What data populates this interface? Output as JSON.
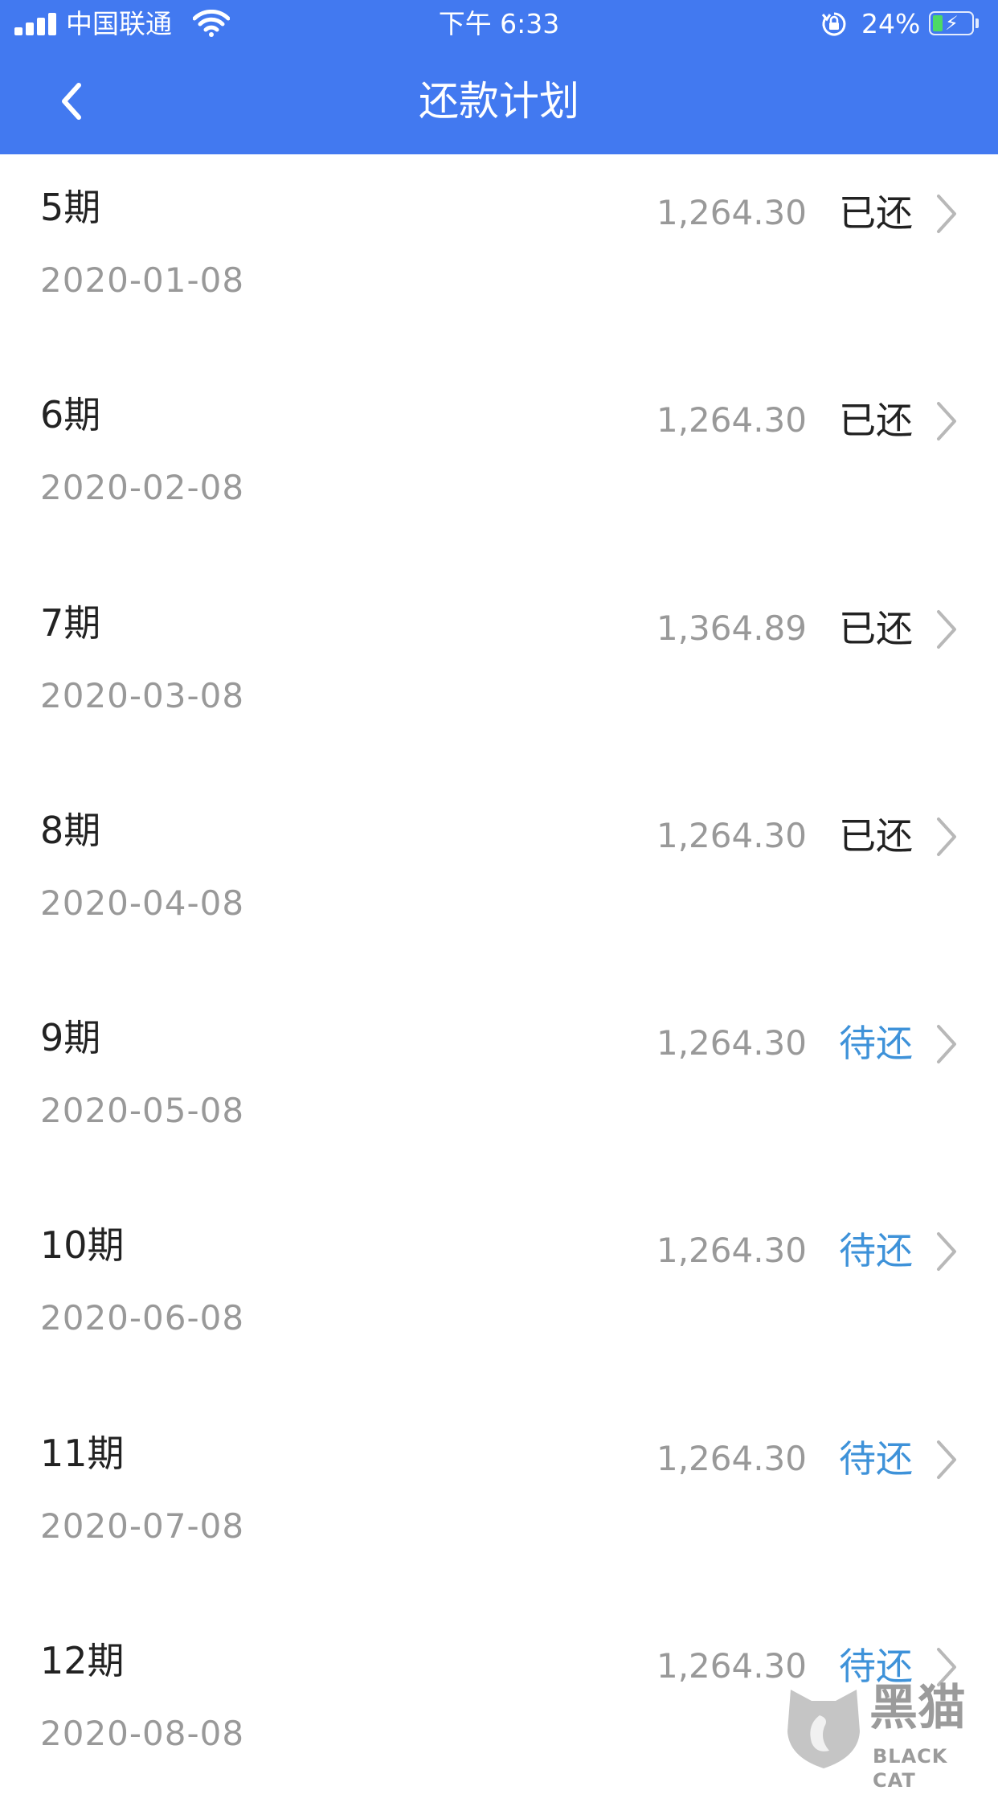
{
  "status_bar": {
    "carrier": "中国联通",
    "time": "下午 6:33",
    "battery_percent": "24%",
    "battery_level": 0.24,
    "icons": [
      "signal-icon",
      "wifi-icon",
      "rotation-lock-icon",
      "battery-charging-icon"
    ]
  },
  "nav": {
    "title": "还款计划",
    "back_icon": "chevron-left-icon"
  },
  "installments": [
    {
      "period": "5期",
      "date": "2020-01-08",
      "amount": "1,264.30",
      "status": "已还",
      "state": "paid"
    },
    {
      "period": "6期",
      "date": "2020-02-08",
      "amount": "1,264.30",
      "status": "已还",
      "state": "paid"
    },
    {
      "period": "7期",
      "date": "2020-03-08",
      "amount": "1,364.89",
      "status": "已还",
      "state": "paid"
    },
    {
      "period": "8期",
      "date": "2020-04-08",
      "amount": "1,264.30",
      "status": "已还",
      "state": "paid"
    },
    {
      "period": "9期",
      "date": "2020-05-08",
      "amount": "1,264.30",
      "status": "待还",
      "state": "pending"
    },
    {
      "period": "10期",
      "date": "2020-06-08",
      "amount": "1,264.30",
      "status": "待还",
      "state": "pending"
    },
    {
      "period": "11期",
      "date": "2020-07-08",
      "amount": "1,264.30",
      "status": "待还",
      "state": "pending"
    },
    {
      "period": "12期",
      "date": "2020-08-08",
      "amount": "1,264.30",
      "status": "待还",
      "state": "pending"
    }
  ],
  "watermark": {
    "cn": "黑猫",
    "en": "BLACK CAT"
  },
  "colors": {
    "header_bg": "#4279F0",
    "paid_text": "#222222",
    "pending_text": "#3E92D9",
    "secondary_text": "#999999"
  }
}
